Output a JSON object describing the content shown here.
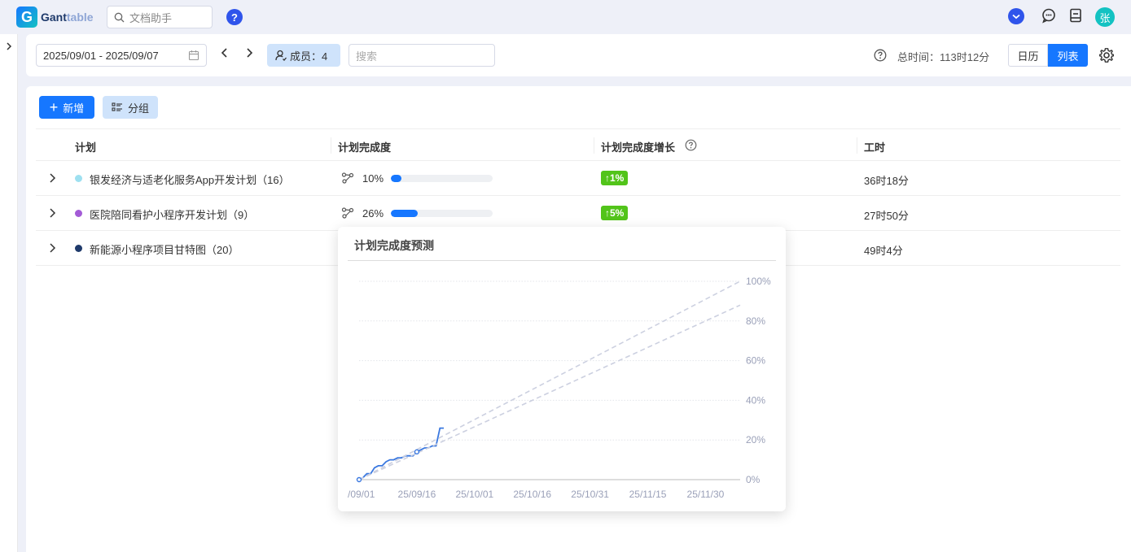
{
  "app": {
    "logo_letter": "G",
    "name_main": "Gant",
    "name_light": "table"
  },
  "topbar": {
    "doc_search_placeholder": "文档助手",
    "help_label": "?",
    "avatar_text": "张"
  },
  "toolbar": {
    "date_range": "2025/09/01 - 2025/09/07",
    "members_label": "成员：4",
    "search_placeholder": "搜索",
    "total_time": "总时间：113时12分",
    "view_calendar": "日历",
    "view_list": "列表"
  },
  "actions": {
    "add_label": "新增",
    "group_label": "分组"
  },
  "table": {
    "headers": {
      "plan": "计划",
      "progress": "计划完成度",
      "growth": "计划完成度增长",
      "hours": "工时"
    },
    "rows": [
      {
        "name": "银发经济与适老化服务App开发计划（16）",
        "dot_color": "#9ee0f0",
        "progress_text": "10%",
        "progress": 10,
        "growth": "↑1%",
        "hours": "36时18分"
      },
      {
        "name": "医院陪同看护小程序开发计划（9）",
        "dot_color": "#a35bd6",
        "progress_text": "26%",
        "progress": 26,
        "growth": "↑5%",
        "hours": "27时50分"
      },
      {
        "name": "新能源小程序项目甘特图（20）",
        "dot_color": "#1f3a6b",
        "hours": "49时4分"
      }
    ]
  },
  "popover": {
    "title": "计划完成度预测"
  },
  "chart_data": {
    "type": "line",
    "x_ticks": [
      "/09/01",
      "25/09/16",
      "25/10/01",
      "25/10/16",
      "25/10/31",
      "25/11/15",
      "25/11/30"
    ],
    "y_ticks": [
      "0%",
      "20%",
      "40%",
      "60%",
      "80%",
      "100%"
    ],
    "ylim": [
      0,
      100
    ],
    "xlim_days": [
      0,
      99
    ],
    "grid": true,
    "series": [
      {
        "style": "solid",
        "color": "#3a78e0",
        "points": [
          [
            0,
            0
          ],
          [
            1,
            1
          ],
          [
            2,
            3
          ],
          [
            3,
            3
          ],
          [
            4,
            6
          ],
          [
            5,
            7
          ],
          [
            6,
            7
          ],
          [
            7,
            9
          ],
          [
            8,
            10
          ],
          [
            9,
            10
          ],
          [
            10,
            11
          ],
          [
            11,
            11
          ],
          [
            12,
            12
          ],
          [
            13,
            12
          ],
          [
            14,
            12
          ],
          [
            15,
            14
          ],
          [
            16,
            15
          ],
          [
            17,
            16
          ],
          [
            18,
            16
          ],
          [
            19,
            17
          ],
          [
            20,
            17
          ],
          [
            21,
            26
          ],
          [
            22,
            26
          ]
        ]
      },
      {
        "style": "dashed",
        "color": "#ccd0e0",
        "points": [
          [
            0,
            0
          ],
          [
            99,
            100
          ]
        ]
      },
      {
        "style": "dashed",
        "color": "#ccd0e0",
        "points": [
          [
            0,
            0
          ],
          [
            99,
            88
          ]
        ]
      }
    ],
    "markers": [
      [
        0,
        0
      ],
      [
        15,
        14
      ]
    ]
  },
  "colors": {
    "accent": "#1677ff",
    "growth": "#52c41a"
  }
}
